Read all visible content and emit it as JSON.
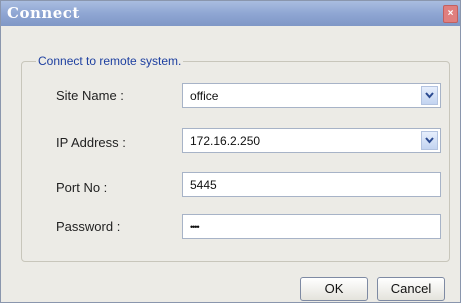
{
  "window": {
    "title": "Connect",
    "close_glyph": "×"
  },
  "group": {
    "label": "Connect to remote system."
  },
  "fields": {
    "site_name": {
      "label": "Site Name :",
      "value": "office"
    },
    "ip_address": {
      "label": "IP Address :",
      "value": "172.16.2.250"
    },
    "port": {
      "label": "Port No :",
      "value": "5445"
    },
    "password": {
      "label": "Password :",
      "value": "••••"
    }
  },
  "buttons": {
    "ok": "OK",
    "cancel": "Cancel"
  },
  "icons": {
    "dropdown": "chevron-down-icon",
    "close": "close-icon"
  },
  "colors": {
    "title_bar": "#8fa6d3",
    "group_label": "#1d3fa0",
    "close": "#e07f7f"
  }
}
